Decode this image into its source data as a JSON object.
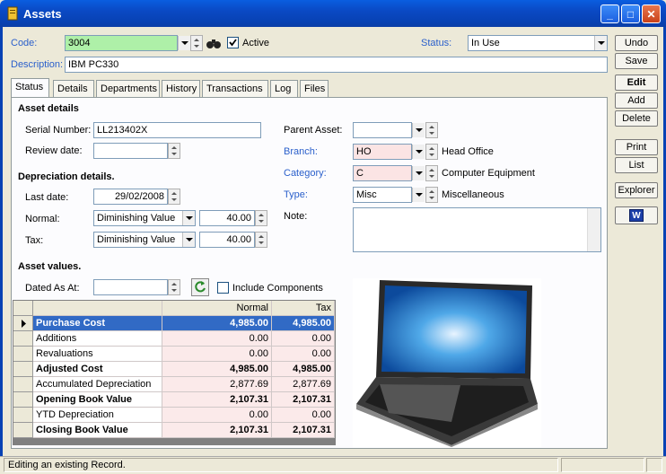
{
  "window": {
    "title": "Assets"
  },
  "form": {
    "code_label": "Code:",
    "code_value": "3004",
    "active_label": "Active",
    "status_label": "Status:",
    "status_value": "In Use",
    "description_label": "Description:",
    "description_value": "IBM PC330"
  },
  "tabs": [
    "Status",
    "Details",
    "Departments",
    "History",
    "Transactions",
    "Log",
    "Files"
  ],
  "asset_details": {
    "header": "Asset details",
    "serial_label": "Serial Number:",
    "serial_value": "LL213402X",
    "review_label": "Review date:",
    "review_value": "",
    "parent_label": "Parent Asset:",
    "parent_value": "",
    "branch_label": "Branch:",
    "branch_code": "HO",
    "branch_name": "Head Office",
    "category_label": "Category:",
    "category_code": "C",
    "category_name": "Computer Equipment",
    "type_label": "Type:",
    "type_code": "Misc",
    "type_name": "Miscellaneous",
    "note_label": "Note:",
    "note_value": ""
  },
  "depreciation": {
    "header": "Depreciation details.",
    "last_label": "Last date:",
    "last_value": "29/02/2008",
    "normal_label": "Normal:",
    "normal_method": "Diminishing Value",
    "normal_rate": "40.00",
    "tax_label": "Tax:",
    "tax_method": "Diminishing Value",
    "tax_rate": "40.00"
  },
  "values": {
    "header": "Asset values.",
    "dated_label": "Dated As At:",
    "dated_value": "",
    "include_label": "Include Components",
    "col_normal": "Normal",
    "col_tax": "Tax",
    "rows": [
      {
        "name": "Purchase Cost",
        "normal": "4,985.00",
        "tax": "4,985.00",
        "bold": true,
        "selected": true
      },
      {
        "name": "Additions",
        "normal": "0.00",
        "tax": "0.00",
        "bold": false
      },
      {
        "name": "Revaluations",
        "normal": "0.00",
        "tax": "0.00",
        "bold": false
      },
      {
        "name": "Adjusted Cost",
        "normal": "4,985.00",
        "tax": "4,985.00",
        "bold": true
      },
      {
        "name": "Accumulated Depreciation",
        "normal": "2,877.69",
        "tax": "2,877.69",
        "bold": false
      },
      {
        "name": "Opening Book Value",
        "normal": "2,107.31",
        "tax": "2,107.31",
        "bold": true
      },
      {
        "name": "YTD Depreciation",
        "normal": "0.00",
        "tax": "0.00",
        "bold": false
      },
      {
        "name": "Closing Book Value",
        "normal": "2,107.31",
        "tax": "2,107.31",
        "bold": true
      }
    ]
  },
  "buttons": {
    "undo": "Undo",
    "save": "Save",
    "edit": "Edit",
    "add": "Add",
    "delete": "Delete",
    "print": "Print",
    "list": "List",
    "explorer": "Explorer",
    "word": "W"
  },
  "statusbar": {
    "message": "Editing an existing Record."
  },
  "colors": {
    "accent_blue": "#2a5fcb",
    "grid_select": "#316ac5",
    "code_green": "#aef0a8"
  }
}
